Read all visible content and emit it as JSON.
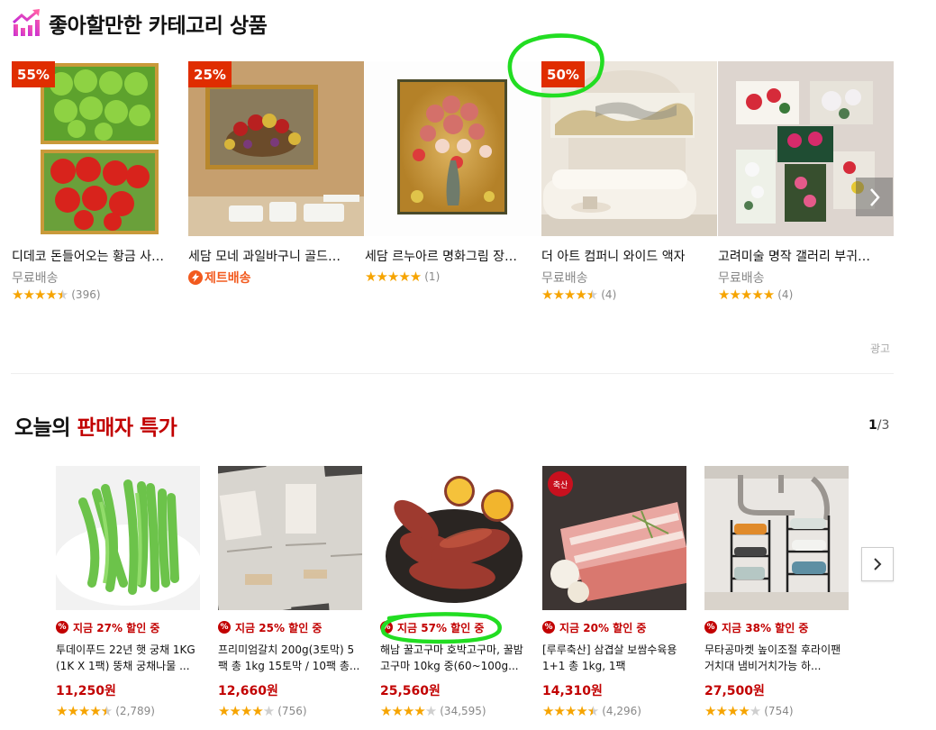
{
  "section1": {
    "title": "좋아할만한 카테고리 상품",
    "ad_label": "광고",
    "products": [
      {
        "discount": "55%",
        "name": "디데코 돈들어오는 황금 사과 풍수 그림",
        "shipping": "무료배송",
        "jet": false,
        "stars": 4.5,
        "reviews": "(396)"
      },
      {
        "discount": "25%",
        "name": "세담 모네 과일바구니 골드 액자",
        "shipping": "",
        "jet": true,
        "jet_label": "제트배송",
        "stars": 0,
        "reviews": ""
      },
      {
        "discount": "",
        "name": "세담 르누아르 명화그림 장미 액자",
        "shipping": "",
        "jet": false,
        "stars": 5,
        "reviews": "(1)"
      },
      {
        "discount": "50%",
        "name": "더 아트 컴퍼니 와이드 액자",
        "shipping": "무료배송",
        "jet": false,
        "stars": 4.5,
        "reviews": "(4)"
      },
      {
        "discount": "",
        "name": "고려미술 명작 갤러리 부귀모란도",
        "shipping": "무료배송",
        "jet": false,
        "stars": 5,
        "reviews": "(4)"
      }
    ]
  },
  "section2": {
    "title_prefix": "오늘의",
    "title_highlight": "판매자 특가",
    "pager_current": "1",
    "pager_total": "/3",
    "deals": [
      {
        "discount": "지금 27% 할인 중",
        "name": "투데이푸드 22년 햇 궁채 1KG (1K X 1팩) 뚱채 궁채나물 ...",
        "price": "11,250원",
        "stars": 4.5,
        "reviews": "(2,789)"
      },
      {
        "discount": "지금 25% 할인 중",
        "name": "프리미엄갈치 200g(3토막) 5팩 총 1kg 15토막 / 10팩 총...",
        "price": "12,660원",
        "stars": 4,
        "reviews": "(756)"
      },
      {
        "discount": "지금 57% 할인 중",
        "name": "해남 꿀고구마 호박고구마, 꿀밤고구마 10kg 중(60~100g...",
        "price": "25,560원",
        "stars": 4,
        "reviews": "(34,595)"
      },
      {
        "discount": "지금 20% 할인 중",
        "name": "[루루축산] 삼겹살 보쌈수육용 1+1 총 1kg, 1팩",
        "price": "14,310원",
        "stars": 4.5,
        "reviews": "(4,296)"
      },
      {
        "discount": "지금 38% 할인 중",
        "name": "무타공마켓 높이조절 후라이팬거치대 냄비거치가능 하...",
        "price": "27,500원",
        "stars": 4,
        "reviews": "(754)"
      }
    ]
  },
  "colors": {
    "accent_red": "#c20000",
    "badge_red": "#e02d00",
    "star": "#f6a400",
    "annotation_green": "#22dd22"
  }
}
